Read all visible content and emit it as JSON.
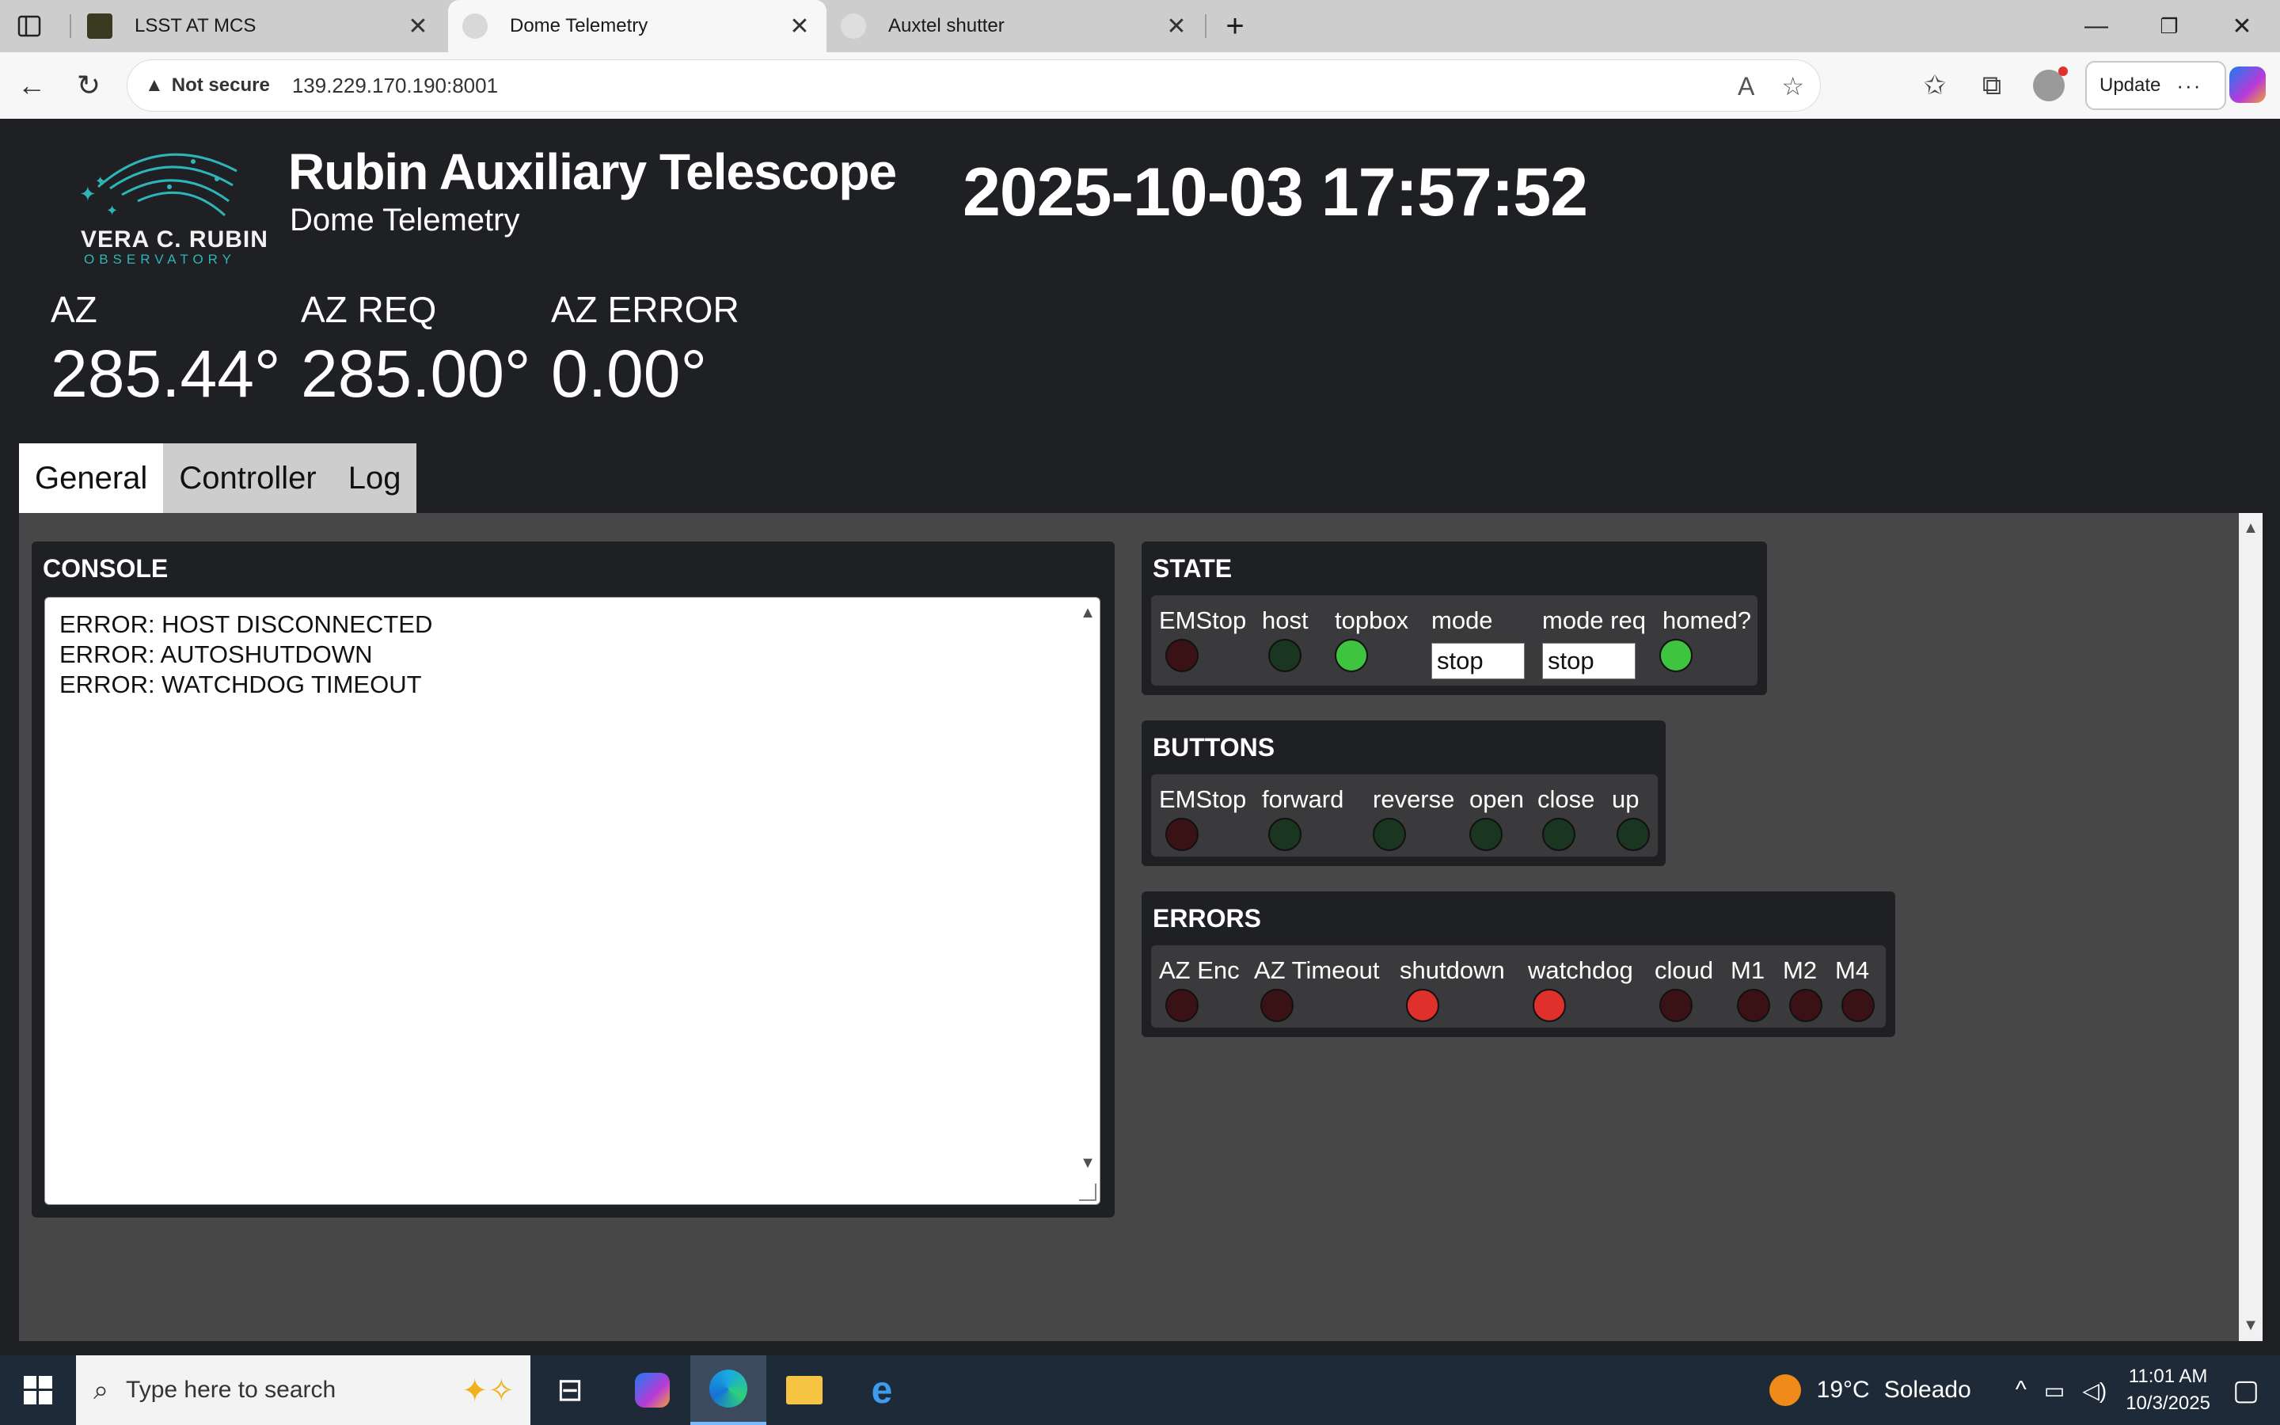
{
  "browser": {
    "tabs": [
      {
        "title": "LSST AT MCS"
      },
      {
        "title": "Dome Telemetry",
        "active": true
      },
      {
        "title": "Auxtel shutter"
      }
    ],
    "security_label": "Not secure",
    "url": "139.229.170.190:8001",
    "update_label": "Update"
  },
  "header": {
    "logo_line1": "VERA C. RUBIN",
    "logo_line2": "OBSERVATORY",
    "title": "Rubin Auxiliary Telescope",
    "subtitle": "Dome Telemetry",
    "datetime": "2025-10-03 17:57:52"
  },
  "metrics": [
    {
      "label": "AZ",
      "value": "285.44°"
    },
    {
      "label": "AZ REQ",
      "value": "285.00°"
    },
    {
      "label": "AZ ERROR",
      "value": "0.00°"
    }
  ],
  "tabs": [
    "General",
    "Controller",
    "Log"
  ],
  "console": {
    "heading": "CONSOLE",
    "lines": [
      "ERROR: HOST DISCONNECTED",
      "ERROR: AUTOSHUTDOWN",
      "ERROR: WATCHDOG TIMEOUT"
    ]
  },
  "state": {
    "heading": "STATE",
    "labels": [
      "EMStop",
      "host",
      "topbox",
      "mode",
      "mode req",
      "homed?"
    ],
    "mode_value": "stop",
    "mode_req_value": "stop",
    "leds": {
      "EMStop": "off-red",
      "host": "off-green",
      "topbox": "on-green",
      "homed": "on-green"
    }
  },
  "buttons": {
    "heading": "BUTTONS",
    "labels": [
      "EMStop",
      "forward",
      "reverse",
      "open",
      "close",
      "up"
    ],
    "leds": [
      "off-red",
      "off-green",
      "off-green",
      "off-green",
      "off-green",
      "off-green"
    ]
  },
  "errors": {
    "heading": "ERRORS",
    "labels": [
      "AZ Enc",
      "AZ Timeout",
      "shutdown",
      "watchdog",
      "cloud",
      "M1",
      "M2",
      "M4"
    ],
    "leds": [
      "off-red",
      "off-red",
      "on-red",
      "on-red",
      "off-red",
      "off-red",
      "off-red",
      "off-red"
    ]
  },
  "taskbar": {
    "search_placeholder": "Type here to search",
    "temperature": "19°C",
    "weather": "Soleado",
    "time": "11:01 AM",
    "date": "10/3/2025"
  },
  "colors": {
    "page_bg": "#1f2023",
    "content_bg": "#474747",
    "led_on_green": "#3ec43e",
    "led_on_red": "#e0302c",
    "led_off_green": "#1a3520",
    "led_off_red": "#3a1216"
  }
}
